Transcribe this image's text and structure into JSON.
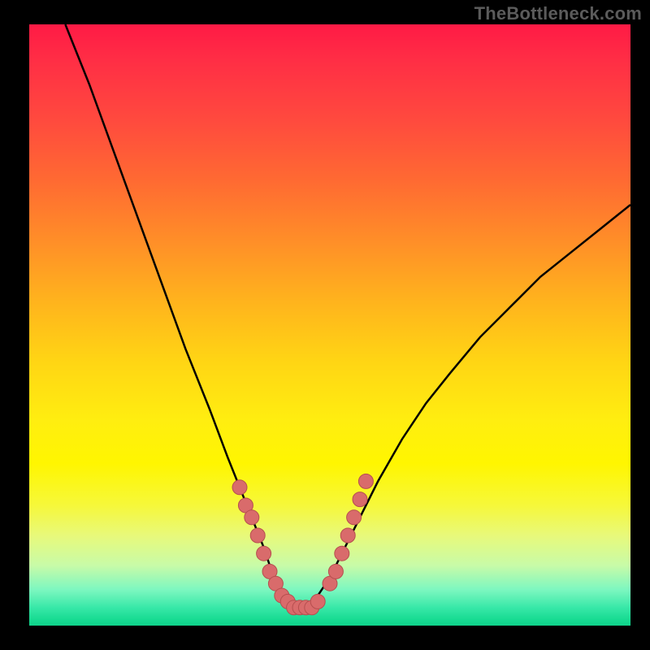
{
  "watermark": "TheBottleneck.com",
  "colors": {
    "background": "#000000",
    "curve": "#000000",
    "markers_fill": "#d96b6b",
    "markers_stroke": "#b64f4f",
    "gradient_stops": [
      "#ff1a45",
      "#ff2e45",
      "#ff4a3e",
      "#ff6a32",
      "#ff8e28",
      "#ffb31d",
      "#ffd514",
      "#ffee10",
      "#fff600",
      "#f6f83a",
      "#e8f97a",
      "#c8fba8",
      "#7df7c0",
      "#38e8a8",
      "#17db92",
      "#10d38a"
    ]
  },
  "chart_data": {
    "type": "line",
    "title": "",
    "xlabel": "",
    "ylabel": "",
    "xlim": [
      0,
      100
    ],
    "ylim": [
      0,
      100
    ],
    "series": [
      {
        "name": "bottleneck-curve",
        "x": [
          6,
          10,
          14,
          18,
          22,
          26,
          30,
          33,
          35,
          37,
          39,
          40,
          41,
          42,
          43,
          44,
          45,
          46,
          47,
          48,
          50,
          52,
          55,
          58,
          62,
          66,
          70,
          75,
          80,
          85,
          90,
          95,
          100
        ],
        "y": [
          100,
          90,
          79,
          68,
          57,
          46,
          36,
          28,
          23,
          18,
          13,
          10,
          7,
          5,
          4,
          3,
          3,
          3,
          4,
          5,
          8,
          12,
          18,
          24,
          31,
          37,
          42,
          48,
          53,
          58,
          62,
          66,
          70
        ]
      }
    ],
    "markers": {
      "name": "highlighted-points",
      "left_cluster": [
        {
          "x": 35,
          "y": 23
        },
        {
          "x": 36,
          "y": 20
        },
        {
          "x": 37,
          "y": 18
        },
        {
          "x": 38,
          "y": 15
        },
        {
          "x": 39,
          "y": 12
        },
        {
          "x": 40,
          "y": 9
        },
        {
          "x": 41,
          "y": 7
        },
        {
          "x": 42,
          "y": 5
        }
      ],
      "basin": [
        {
          "x": 43,
          "y": 4
        },
        {
          "x": 44,
          "y": 3
        },
        {
          "x": 45,
          "y": 3
        },
        {
          "x": 46,
          "y": 3
        },
        {
          "x": 47,
          "y": 3
        },
        {
          "x": 48,
          "y": 4
        }
      ],
      "right_cluster": [
        {
          "x": 50,
          "y": 7
        },
        {
          "x": 51,
          "y": 9
        },
        {
          "x": 52,
          "y": 12
        },
        {
          "x": 53,
          "y": 15
        },
        {
          "x": 54,
          "y": 18
        },
        {
          "x": 55,
          "y": 21
        },
        {
          "x": 56,
          "y": 24
        }
      ]
    }
  }
}
